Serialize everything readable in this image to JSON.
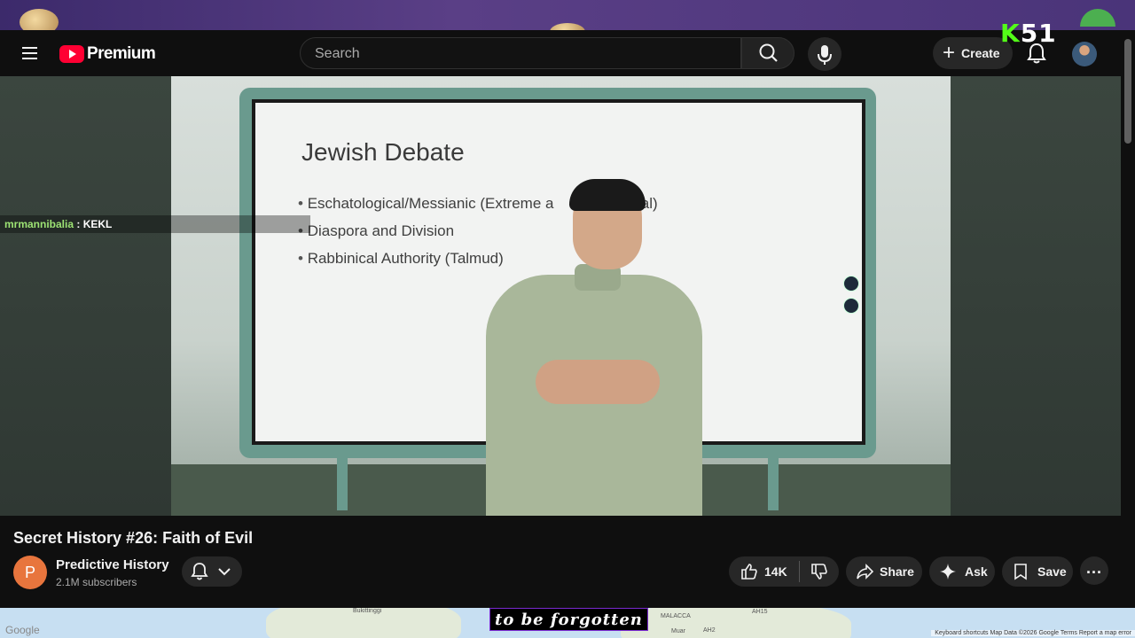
{
  "masthead": {
    "brand": "Premium",
    "search_placeholder": "Search",
    "create_label": "Create",
    "overlay_badge": "51"
  },
  "video": {
    "slide": {
      "title": "Jewish Debate",
      "bullets": [
        "Eschatological/Messianic (Extreme a",
        "Diaspora and Division",
        "Rabbinical Authority (Talmud)"
      ],
      "bullet_tail": "ical)"
    },
    "chat": {
      "user": "mrmannibalia",
      "separator": " : ",
      "message": "KEKL"
    },
    "title": "Secret History #26: Faith of Evil"
  },
  "channel": {
    "initial": "P",
    "name": "Predictive History",
    "subscribers": "2.1M subscribers"
  },
  "actions": {
    "likes": "14K",
    "share": "Share",
    "ask": "Ask",
    "save": "Save"
  },
  "map": {
    "provider": "Google",
    "labels": [
      "Bukittinggi",
      "MALACCA",
      "Muar",
      "AH2",
      "AH15"
    ],
    "attribution": "Keyboard shortcuts   Map Data ©2026 Google   Terms   Report a map error"
  },
  "caption": "to be forgotten",
  "colors": {
    "brand_red": "#ff0033",
    "kick_green": "#53fc18",
    "channel_avatar": "#e8753d",
    "chat_user": "#9de374"
  }
}
